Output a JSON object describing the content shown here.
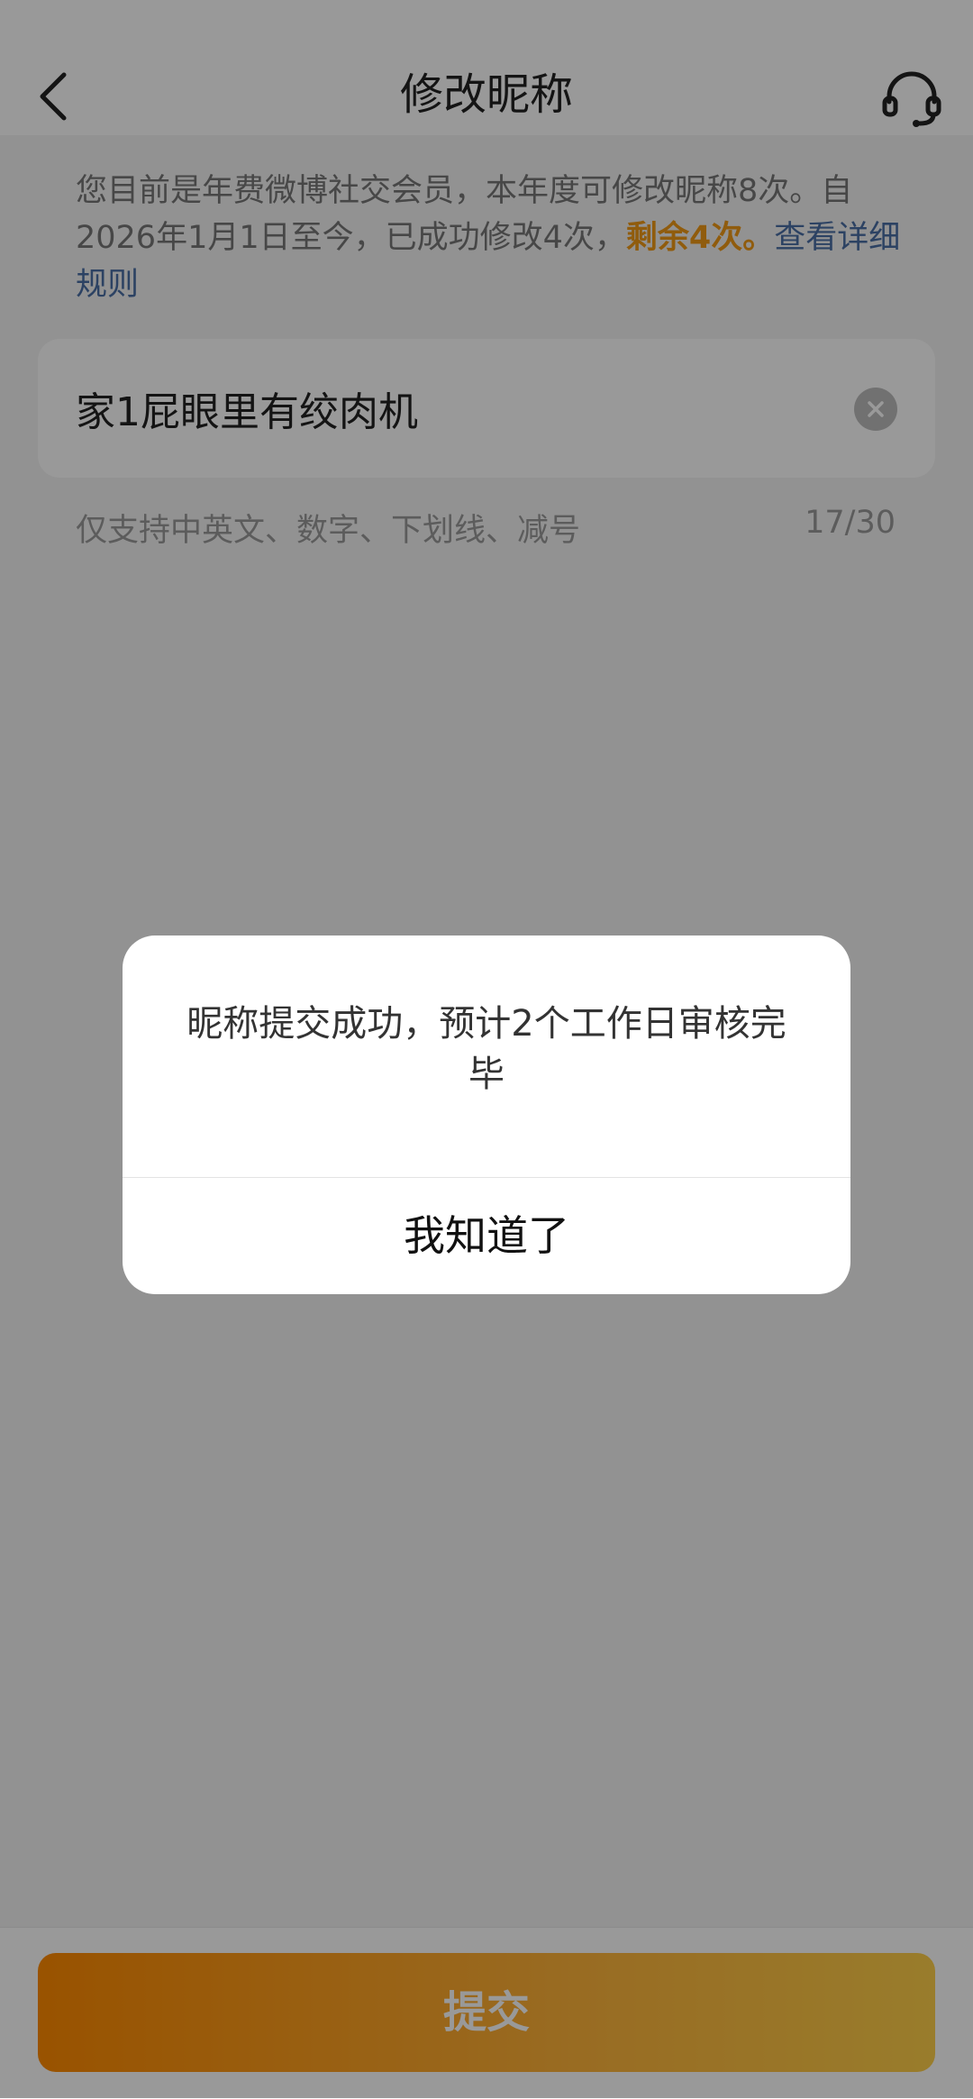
{
  "header": {
    "title": "修改昵称",
    "back_icon": "chevron-left-icon",
    "support_icon": "headset-icon"
  },
  "notice": {
    "text_part1": "您目前是年费微博社交会员，本年度可修改昵称8次。自2026年1月1日至今，已成功修改4次，",
    "remaining": "剩余4次。",
    "rules_link": "查看详细规则"
  },
  "nickname": {
    "value": "家1屁眼里有绞肉机",
    "clear_icon": "clear-icon"
  },
  "hint": {
    "text": "仅支持中英文、数字、下划线、减号",
    "counter": "17/30"
  },
  "submit": {
    "label": "提交"
  },
  "dialog": {
    "message": "昵称提交成功，预计2个工作日审核完毕",
    "confirm_label": "我知道了"
  },
  "colors": {
    "accent": "#f19a16",
    "link": "#4a6fa5",
    "submit_gradient_start": "#ff8a00",
    "submit_gradient_end": "#ffd04a"
  }
}
